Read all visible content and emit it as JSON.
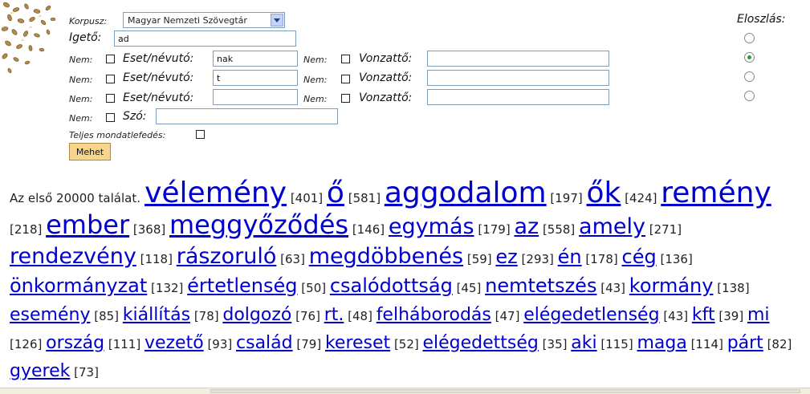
{
  "form": {
    "corpus_label": "Korpusz:",
    "corpus_value": "Magyar Nemzeti Szövegtár",
    "verb_label": "Igető:",
    "verb_value": "ad",
    "neg_label": "Nem:",
    "case_label": "Eset/névutó:",
    "valency_label": "Vonzattő:",
    "rows": [
      {
        "case_value": "nak",
        "valency_value": ""
      },
      {
        "case_value": "t",
        "valency_value": ""
      },
      {
        "case_value": "",
        "valency_value": ""
      }
    ],
    "word_label": "Szó:",
    "word_value": "",
    "full_cover_label": "Teljes mondatlefedés:",
    "submit_label": "Mehet"
  },
  "distribution": {
    "title": "Eloszlás:",
    "options_count": 4,
    "selected_index": 1
  },
  "results": {
    "intro": "Az első 20000 találat.",
    "items": [
      {
        "word": "vélemény",
        "count": "[401]",
        "size": 36
      },
      {
        "word": "ő",
        "count": "[581]",
        "size": 36
      },
      {
        "word": "aggodalom",
        "count": "[197]",
        "size": 36
      },
      {
        "word": "ők",
        "count": "[424]",
        "size": 36
      },
      {
        "word": "remény",
        "count": "[218]",
        "size": 36
      },
      {
        "word": "ember",
        "count": "[368]",
        "size": 32
      },
      {
        "word": "meggyőződés",
        "count": "[146]",
        "size": 32
      },
      {
        "word": "egymás",
        "count": "[179]",
        "size": 27
      },
      {
        "word": "az",
        "count": "[558]",
        "size": 27
      },
      {
        "word": "amely",
        "count": "[271]",
        "size": 27
      },
      {
        "word": "rendezvény",
        "count": "[118]",
        "size": 27
      },
      {
        "word": "rászoruló",
        "count": "[63]",
        "size": 27
      },
      {
        "word": "megdöbbenés",
        "count": "[59]",
        "size": 27
      },
      {
        "word": "ez",
        "count": "[293]",
        "size": 24
      },
      {
        "word": "én",
        "count": "[178]",
        "size": 24
      },
      {
        "word": "cég",
        "count": "[136]",
        "size": 24
      },
      {
        "word": "önkormányzat",
        "count": "[132]",
        "size": 24
      },
      {
        "word": "értetlenség",
        "count": "[50]",
        "size": 24
      },
      {
        "word": "csalódottság",
        "count": "[45]",
        "size": 24
      },
      {
        "word": "nemtetszés",
        "count": "[43]",
        "size": 24
      },
      {
        "word": "kormány",
        "count": "[138]",
        "size": 24
      },
      {
        "word": "esemény",
        "count": "[85]",
        "size": 22
      },
      {
        "word": "kiállítás",
        "count": "[78]",
        "size": 22
      },
      {
        "word": "dolgozó",
        "count": "[76]",
        "size": 22
      },
      {
        "word": "rt.",
        "count": "[48]",
        "size": 22
      },
      {
        "word": "felháborodás",
        "count": "[47]",
        "size": 22
      },
      {
        "word": "elégedetlenség",
        "count": "[43]",
        "size": 22
      },
      {
        "word": "kft",
        "count": "[39]",
        "size": 22
      },
      {
        "word": "mi",
        "count": "[126]",
        "size": 22
      },
      {
        "word": "ország",
        "count": "[111]",
        "size": 22
      },
      {
        "word": "vezető",
        "count": "[93]",
        "size": 22
      },
      {
        "word": "család",
        "count": "[79]",
        "size": 22
      },
      {
        "word": "kereset",
        "count": "[52]",
        "size": 22
      },
      {
        "word": "elégedettség",
        "count": "[35]",
        "size": 22
      },
      {
        "word": "aki",
        "count": "[115]",
        "size": 22
      },
      {
        "word": "maga",
        "count": "[114]",
        "size": 22
      },
      {
        "word": "párt",
        "count": "[82]",
        "size": 22
      },
      {
        "word": "gyerek",
        "count": "[73]",
        "size": 22
      }
    ]
  },
  "colors": {
    "link": "#0000cc",
    "button": "#f6d68f",
    "radio_selected": "#2f9a2f"
  }
}
